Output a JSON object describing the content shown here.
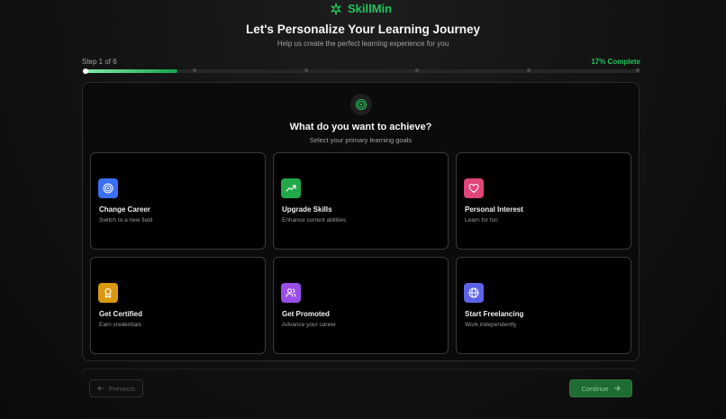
{
  "brand": {
    "name": "SkillMin",
    "color": "#22c55e",
    "icon": "sparkle-icon"
  },
  "header": {
    "title": "Let's Personalize Your Learning Journey",
    "subtitle": "Help us create the perfect learning experience for you"
  },
  "progress": {
    "step_label": "Step 1 of 6",
    "percent_label": "17% Complete",
    "current_step": 1,
    "total_steps": 6,
    "fraction": 0.17
  },
  "question": {
    "icon": "target-icon",
    "title": "What do you want to achieve?",
    "subtitle": "Select your primary learning goals"
  },
  "goals": [
    {
      "title": "Change Career",
      "desc": "Switch to a new field",
      "icon": "target-icon",
      "color": "#3b6ff5"
    },
    {
      "title": "Upgrade Skills",
      "desc": "Enhance current abilities",
      "icon": "trending-up-icon",
      "color": "#22a84b"
    },
    {
      "title": "Personal Interest",
      "desc": "Learn for fun",
      "icon": "heart-icon",
      "color": "#e0457b"
    },
    {
      "title": "Get Certified",
      "desc": "Earn credentials",
      "icon": "award-icon",
      "color": "#d99a12"
    },
    {
      "title": "Get Promoted",
      "desc": "Advance your career",
      "icon": "users-icon",
      "color": "#9a4ee8"
    },
    {
      "title": "Start Freelancing",
      "desc": "Work independently",
      "icon": "globe-icon",
      "color": "#5c63e6"
    }
  ],
  "nav": {
    "previous_label": "Previous",
    "continue_label": "Continue"
  }
}
